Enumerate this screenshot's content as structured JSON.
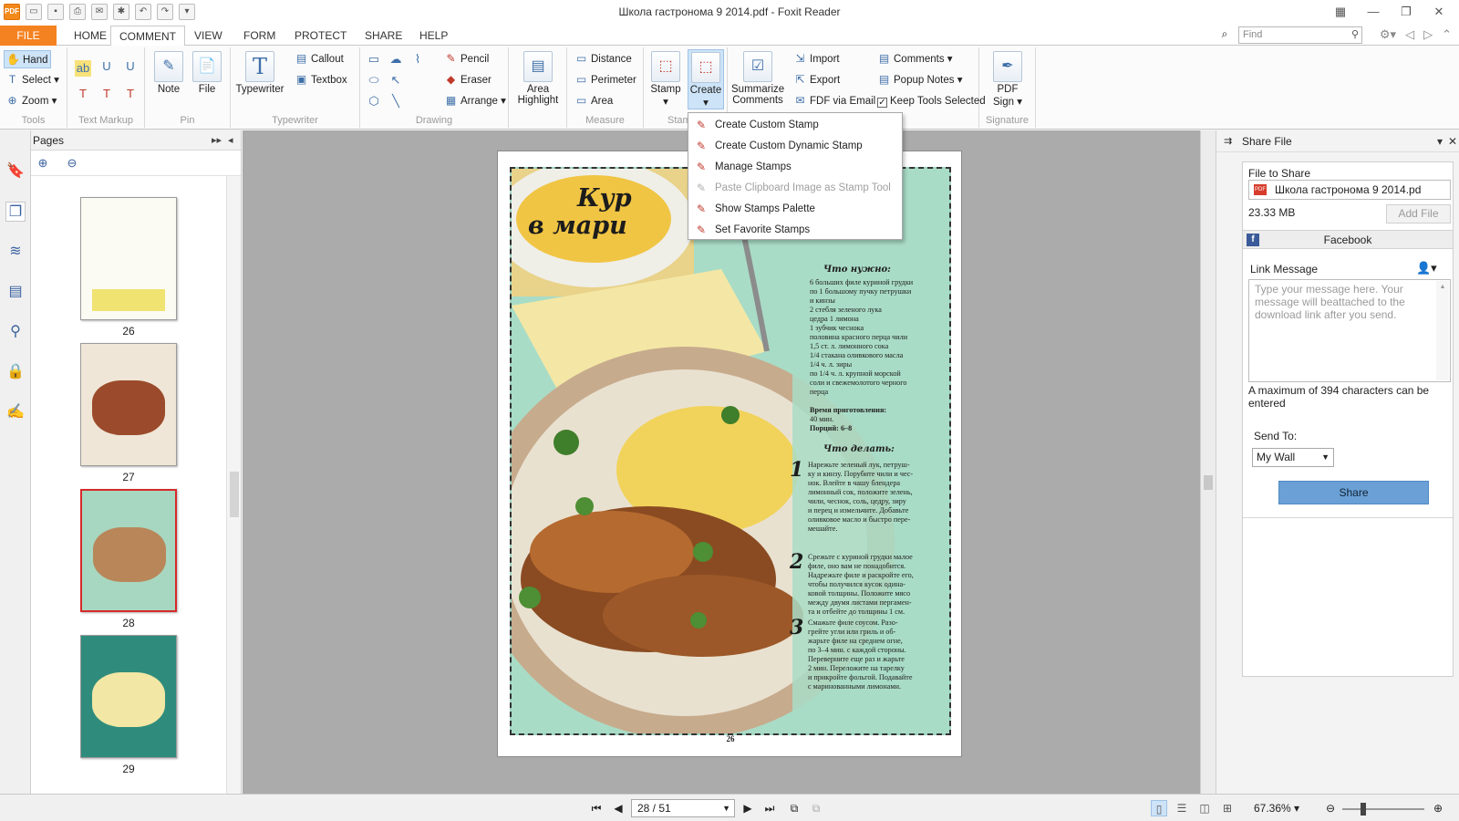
{
  "window": {
    "title": "Школа гастронома 9 2014.pdf - Foxit Reader",
    "controls": {
      "restore_icon": "restore-icon",
      "minimize": "—",
      "maximize": "❐",
      "close": "✕"
    }
  },
  "quick_access": {
    "logo": "PDF"
  },
  "tabs": {
    "file": "FILE",
    "home": "HOME",
    "comment": "COMMENT",
    "view": "VIEW",
    "form": "FORM",
    "protect": "PROTECT",
    "share": "SHARE",
    "help": "HELP"
  },
  "find": {
    "placeholder": "Find"
  },
  "ribbon": {
    "tools": {
      "label": "Tools",
      "hand": "Hand",
      "select": "Select",
      "zoom": "Zoom"
    },
    "text_markup": {
      "label": "Text Markup"
    },
    "pin": {
      "label": "Pin",
      "note": "Note",
      "file": "File"
    },
    "typewriter": {
      "label": "Typewriter",
      "typewriter": "Typewriter",
      "callout": "Callout",
      "textbox": "Textbox"
    },
    "drawing": {
      "label": "Drawing",
      "pencil": "Pencil",
      "eraser": "Eraser",
      "arrange": "Arrange"
    },
    "area_highlight": {
      "line1": "Area",
      "line2": "Highlight"
    },
    "measure": {
      "label": "Measure",
      "distance": "Distance",
      "perimeter": "Perimeter",
      "area": "Area"
    },
    "stamp": {
      "label": "Stam",
      "stamp": "Stamp",
      "create": "Create"
    },
    "summarize": {
      "line1": "Summarize",
      "line2": "Comments"
    },
    "manage": {
      "import": "Import",
      "export": "Export",
      "fdf_email": "FDF via Email",
      "comments": "Comments",
      "popup_notes": "Popup Notes",
      "keep_tools": "Keep Tools Selected",
      "keep_tools_checked": "✓"
    },
    "signature": {
      "label": "Signature",
      "line1": "PDF",
      "line2": "Sign"
    }
  },
  "create_menu": {
    "items": [
      {
        "label": "Create Custom Stamp",
        "enabled": true
      },
      {
        "label": "Create Custom Dynamic Stamp",
        "enabled": true
      },
      {
        "label": "Manage Stamps",
        "enabled": true
      },
      {
        "label": "Paste Clipboard Image as Stamp Tool",
        "enabled": false
      },
      {
        "label": "Show Stamps Palette",
        "enabled": true
      },
      {
        "label": "Set Favorite Stamps",
        "enabled": true
      }
    ]
  },
  "pages_panel": {
    "title": "Pages",
    "thumbnails": [
      {
        "label": "26",
        "selected": false
      },
      {
        "label": "27",
        "selected": false
      },
      {
        "label": "28",
        "selected": true
      },
      {
        "label": "29",
        "selected": false
      }
    ]
  },
  "document": {
    "title_line1": "Кур",
    "title_line2": "в мари",
    "needed_heading": "Что нужно:",
    "ingredients": "6 больших филе куриной грудки\nпо 1 большому пучку петрушки\nи кинзы\n2 стебля зеленого лука\nцедра 1 лимона\n1 зубчик чеснока\nполовина красного перца чили\n1,5 ст. л. лимонного сока\n1/4 стакана оливкового масла\n1/4 ч. л. зиры\nпо 1/4 ч. л. крупной морской\nсоли и свежемолотого черного\nперца",
    "time_label": "Время приготовления:",
    "time_value": "40 мин.",
    "portions": "Порций: 6–8",
    "todo_heading": "Что делать:",
    "steps": [
      {
        "num": "1",
        "text": "Нарежьте зеленый лук, петруш-\nку и кинзу. Порубите чили и чес-\nнок. Влейте в чашу блендера\nлимонный сок, положите зелень,\nчили, чеснок, соль, цедру, зиру\nи перец и измельчите. Добавьте\nоливковое масло и быстро пере-\nмешайте."
      },
      {
        "num": "2",
        "text": "Срежьте с куриной грудки малое\nфиле, оно вам не понадобится.\nНадрежьте филе и раскройте его,\nчтобы получился кусок одина-\nковой толщины. Положите мясо\nмежду двумя листами пергамен-\nта и отбейте до толщины 1 см."
      },
      {
        "num": "3",
        "text": "Смажьте филе соусом. Разо-\nгрейте угли или гриль и об-\nжарьте филе на среднем огне,\nпо 3–4 мин. с каждой стороны.\nПереверните еще раз и жарьте\n2 мин. Переложите на тарелку\nи прикройте фольгой. Подавайте\nс маринованными лимонами."
      }
    ],
    "page_number": "26"
  },
  "share_panel": {
    "title": "Share File",
    "file_to_share_label": "File to Share",
    "file_name": "Школа гастронома 9 2014.pd",
    "file_size": "23.33 MB",
    "add_file": "Add File",
    "facebook": "Facebook",
    "link_message_label": "Link Message",
    "message_placeholder": "Type your message here. Your message will beattached to the download link after you send.",
    "limit_note": "A maximum of 394 characters can be entered",
    "send_to_label": "Send To:",
    "send_to_value": "My Wall",
    "share_button": "Share"
  },
  "statusbar": {
    "page_value": "28 / 51",
    "zoom": "67.36%"
  },
  "colors": {
    "file_tab": "#f58220",
    "accent_blue": "#6aa0d6",
    "selected_thumb": "#d62a2a",
    "doc_background": "#ababab"
  }
}
